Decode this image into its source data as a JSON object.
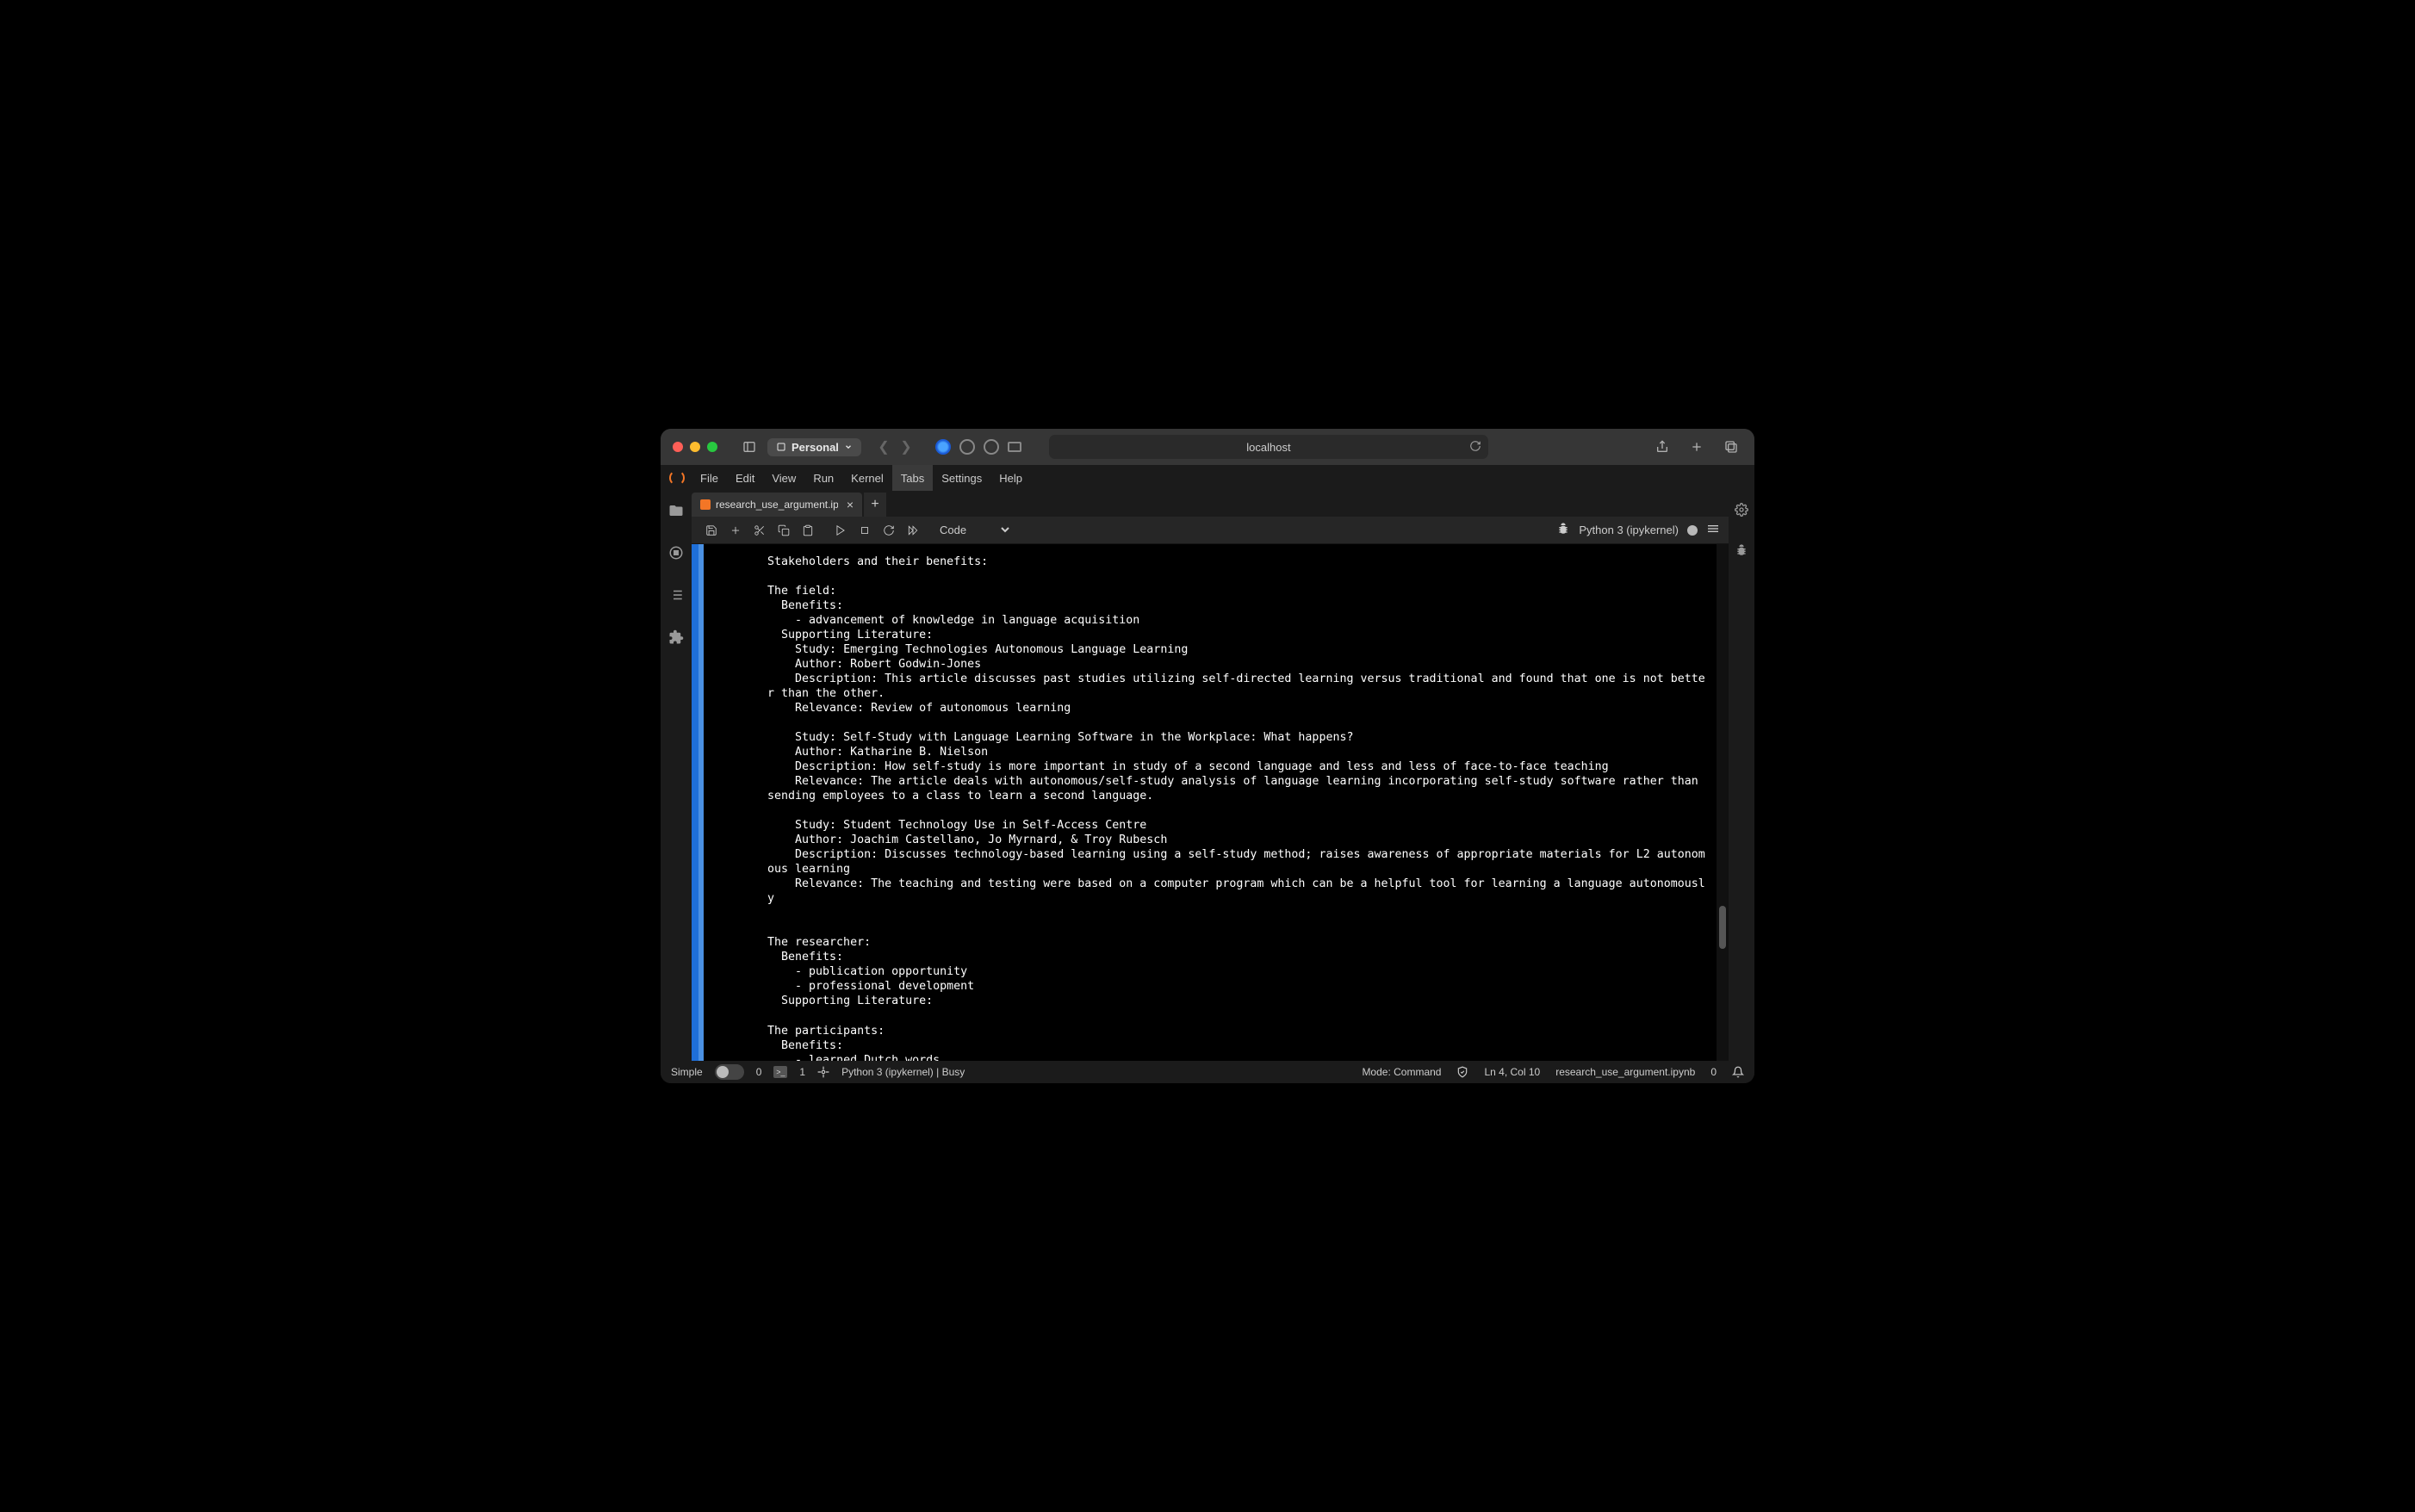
{
  "titlebar": {
    "profile_label": "Personal",
    "address": "localhost"
  },
  "menubar": {
    "items": [
      "File",
      "Edit",
      "View",
      "Run",
      "Kernel",
      "Tabs",
      "Settings",
      "Help"
    ],
    "active_index": 5
  },
  "file_tab": {
    "label": "research_use_argument.ipy"
  },
  "toolbar": {
    "cell_type": "Code",
    "kernel_name": "Python 3 (ipykernel)"
  },
  "cell_output": "Stakeholders and their benefits:\n\nThe field:\n  Benefits:\n    - advancement of knowledge in language acquisition\n  Supporting Literature:\n    Study: Emerging Technologies Autonomous Language Learning\n    Author: Robert Godwin-Jones\n    Description: This article discusses past studies utilizing self-directed learning versus traditional and found that one is not better than the other.\n    Relevance: Review of autonomous learning\n\n    Study: Self-Study with Language Learning Software in the Workplace: What happens?\n    Author: Katharine B. Nielson\n    Description: How self-study is more important in study of a second language and less and less of face-to-face teaching\n    Relevance: The article deals with autonomous/self-study analysis of language learning incorporating self-study software rather than sending employees to a class to learn a second language.\n\n    Study: Student Technology Use in Self-Access Centre\n    Author: Joachim Castellano, Jo Myrnard, & Troy Rubesch\n    Description: Discusses technology-based learning using a self-study method; raises awareness of appropriate materials for L2 autonomous learning\n    Relevance: The teaching and testing were based on a computer program which can be a helpful tool for learning a language autonomously\n\n\nThe researcher:\n  Benefits:\n    - publication opportunity\n    - professional development\n  Supporting Literature:\n\nThe participants:\n  Benefits:\n    - learned Dutch words",
  "statusbar": {
    "simple_label": "Simple",
    "terminals": "0",
    "kernels": "1",
    "kernel_status": "Python 3 (ipykernel) | Busy",
    "mode": "Mode: Command",
    "cursor": "Ln 4, Col 10",
    "filename": "research_use_argument.ipynb",
    "notifications": "0"
  }
}
